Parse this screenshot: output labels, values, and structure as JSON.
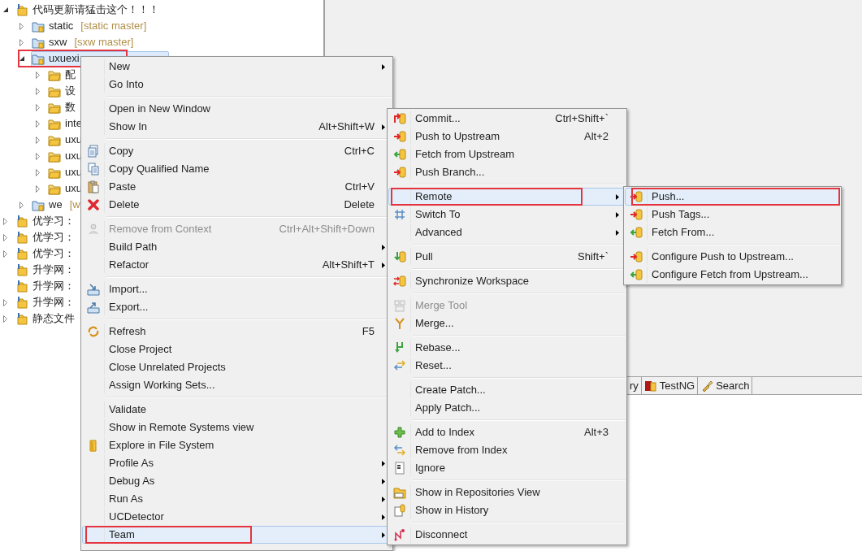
{
  "project_tree": [
    {
      "label": "代码更新请猛击这个！！！",
      "expanded": true,
      "selected": false,
      "annotated": false,
      "children": [
        {
          "label": "static",
          "decoration": "[static master]",
          "expanded": false,
          "selected": false,
          "annotated": false
        },
        {
          "label": "sxw",
          "decoration": "[sxw master]",
          "expanded": false,
          "selected": false,
          "annotated": false
        },
        {
          "label": "uxuexi",
          "expanded": true,
          "selected": true,
          "annotated": true,
          "children": [
            {
              "label": "配",
              "expanded": false,
              "selected": false,
              "annotated": false
            },
            {
              "label": "设",
              "expanded": false,
              "selected": false,
              "annotated": false
            },
            {
              "label": "数",
              "expanded": false,
              "selected": false,
              "annotated": false
            },
            {
              "label": "inte",
              "expanded": false,
              "selected": false,
              "annotated": false
            },
            {
              "label": "uxu",
              "expanded": false,
              "selected": false,
              "annotated": false
            },
            {
              "label": "uxu",
              "expanded": false,
              "selected": false,
              "annotated": false
            },
            {
              "label": "uxu",
              "expanded": false,
              "selected": false,
              "annotated": false
            },
            {
              "label": "uxu",
              "expanded": false,
              "selected": false,
              "annotated": false
            }
          ]
        },
        {
          "label": "we",
          "decoration": "[w",
          "expanded": false,
          "selected": false,
          "annotated": false
        }
      ]
    },
    {
      "label": "优学习：",
      "expanded": false,
      "selected": false,
      "annotated": false
    },
    {
      "label": "优学习：",
      "expanded": false,
      "selected": false,
      "annotated": false
    },
    {
      "label": "优学习：",
      "expanded": false,
      "selected": false,
      "annotated": false
    },
    {
      "label": "升学网：",
      "selected": false,
      "annotated": false
    },
    {
      "label": "升学网：",
      "selected": false,
      "annotated": false
    },
    {
      "label": "升学网：",
      "expanded": false,
      "selected": false,
      "annotated": false
    },
    {
      "label": "静态文件",
      "expanded": false,
      "selected": false,
      "annotated": false
    }
  ],
  "context_menu": {
    "items": [
      {
        "kind": "item",
        "label": "New",
        "has_submenu": true,
        "disabled": false,
        "selected": false,
        "annotated": false
      },
      {
        "kind": "item",
        "label": "Go Into",
        "disabled": false,
        "selected": false,
        "annotated": false
      },
      {
        "kind": "separator"
      },
      {
        "kind": "item",
        "label": "Open in New Window",
        "disabled": false,
        "selected": false,
        "annotated": false
      },
      {
        "kind": "item",
        "label": "Show In",
        "shortcut": "Alt+Shift+W",
        "has_submenu": true,
        "disabled": false,
        "selected": false,
        "annotated": false
      },
      {
        "kind": "separator"
      },
      {
        "kind": "item",
        "label": "Copy",
        "shortcut": "Ctrl+C",
        "disabled": false,
        "selected": false,
        "annotated": false
      },
      {
        "kind": "item",
        "label": "Copy Qualified Name",
        "disabled": false,
        "selected": false,
        "annotated": false
      },
      {
        "kind": "item",
        "label": "Paste",
        "shortcut": "Ctrl+V",
        "disabled": false,
        "selected": false,
        "annotated": false
      },
      {
        "kind": "item",
        "label": "Delete",
        "shortcut": "Delete",
        "disabled": false,
        "selected": false,
        "annotated": false
      },
      {
        "kind": "separator"
      },
      {
        "kind": "item",
        "label": "Remove from Context",
        "shortcut": "Ctrl+Alt+Shift+Down",
        "disabled": true,
        "selected": false,
        "annotated": false
      },
      {
        "kind": "item",
        "label": "Build Path",
        "has_submenu": true,
        "disabled": false,
        "selected": false,
        "annotated": false
      },
      {
        "kind": "item",
        "label": "Refactor",
        "shortcut": "Alt+Shift+T",
        "has_submenu": true,
        "disabled": false,
        "selected": false,
        "annotated": false
      },
      {
        "kind": "separator"
      },
      {
        "kind": "item",
        "label": "Import...",
        "disabled": false,
        "selected": false,
        "annotated": false
      },
      {
        "kind": "item",
        "label": "Export...",
        "disabled": false,
        "selected": false,
        "annotated": false
      },
      {
        "kind": "separator"
      },
      {
        "kind": "item",
        "label": "Refresh",
        "shortcut": "F5",
        "disabled": false,
        "selected": false,
        "annotated": false
      },
      {
        "kind": "item",
        "label": "Close Project",
        "disabled": false,
        "selected": false,
        "annotated": false
      },
      {
        "kind": "item",
        "label": "Close Unrelated Projects",
        "disabled": false,
        "selected": false,
        "annotated": false
      },
      {
        "kind": "item",
        "label": "Assign Working Sets...",
        "disabled": false,
        "selected": false,
        "annotated": false
      },
      {
        "kind": "separator"
      },
      {
        "kind": "item",
        "label": "Validate",
        "disabled": false,
        "selected": false,
        "annotated": false
      },
      {
        "kind": "item",
        "label": "Show in Remote Systems view",
        "disabled": false,
        "selected": false,
        "annotated": false
      },
      {
        "kind": "item",
        "label": "Explore in File System",
        "disabled": false,
        "selected": false,
        "annotated": false
      },
      {
        "kind": "item",
        "label": "Profile As",
        "has_submenu": true,
        "disabled": false,
        "selected": false,
        "annotated": false
      },
      {
        "kind": "item",
        "label": "Debug As",
        "has_submenu": true,
        "disabled": false,
        "selected": false,
        "annotated": false
      },
      {
        "kind": "item",
        "label": "Run As",
        "has_submenu": true,
        "disabled": false,
        "selected": false,
        "annotated": false
      },
      {
        "kind": "item",
        "label": "UCDetector",
        "has_submenu": true,
        "disabled": false,
        "selected": false,
        "annotated": false
      },
      {
        "kind": "item",
        "label": "Team",
        "has_submenu": true,
        "disabled": false,
        "selected": true,
        "annotated": true
      }
    ]
  },
  "team_submenu": {
    "items": [
      {
        "kind": "item",
        "label": "Commit...",
        "shortcut": "Ctrl+Shift+`",
        "disabled": false,
        "selected": false,
        "annotated": false
      },
      {
        "kind": "item",
        "label": "Push to Upstream",
        "shortcut": "Alt+2",
        "disabled": false,
        "selected": false,
        "annotated": false
      },
      {
        "kind": "item",
        "label": "Fetch from Upstream",
        "disabled": false,
        "selected": false,
        "annotated": false
      },
      {
        "kind": "item",
        "label": "Push Branch...",
        "disabled": false,
        "selected": false,
        "annotated": false
      },
      {
        "kind": "separator"
      },
      {
        "kind": "item",
        "label": "Remote",
        "has_submenu": true,
        "disabled": false,
        "selected": true,
        "annotated": true
      },
      {
        "kind": "item",
        "label": "Switch To",
        "has_submenu": true,
        "disabled": false,
        "selected": false,
        "annotated": false
      },
      {
        "kind": "item",
        "label": "Advanced",
        "has_submenu": true,
        "disabled": false,
        "selected": false,
        "annotated": false
      },
      {
        "kind": "separator"
      },
      {
        "kind": "item",
        "label": "Pull",
        "shortcut": "Shift+`",
        "disabled": false,
        "selected": false,
        "annotated": false
      },
      {
        "kind": "separator"
      },
      {
        "kind": "item",
        "label": "Synchronize Workspace",
        "disabled": false,
        "selected": false,
        "annotated": false
      },
      {
        "kind": "separator"
      },
      {
        "kind": "item",
        "label": "Merge Tool",
        "disabled": true,
        "selected": false,
        "annotated": false
      },
      {
        "kind": "item",
        "label": "Merge...",
        "disabled": false,
        "selected": false,
        "annotated": false
      },
      {
        "kind": "separator"
      },
      {
        "kind": "item",
        "label": "Rebase...",
        "disabled": false,
        "selected": false,
        "annotated": false
      },
      {
        "kind": "item",
        "label": "Reset...",
        "disabled": false,
        "selected": false,
        "annotated": false
      },
      {
        "kind": "separator"
      },
      {
        "kind": "item",
        "label": "Create Patch...",
        "disabled": false,
        "selected": false,
        "annotated": false
      },
      {
        "kind": "item",
        "label": "Apply Patch...",
        "disabled": false,
        "selected": false,
        "annotated": false
      },
      {
        "kind": "separator"
      },
      {
        "kind": "item",
        "label": "Add to Index",
        "shortcut": "Alt+3",
        "disabled": false,
        "selected": false,
        "annotated": false
      },
      {
        "kind": "item",
        "label": "Remove from Index",
        "disabled": false,
        "selected": false,
        "annotated": false
      },
      {
        "kind": "item",
        "label": "Ignore",
        "disabled": false,
        "selected": false,
        "annotated": false
      },
      {
        "kind": "separator"
      },
      {
        "kind": "item",
        "label": "Show in Repositories View",
        "disabled": false,
        "selected": false,
        "annotated": false
      },
      {
        "kind": "item",
        "label": "Show in History",
        "disabled": false,
        "selected": false,
        "annotated": false
      },
      {
        "kind": "separator"
      },
      {
        "kind": "item",
        "label": "Disconnect",
        "disabled": false,
        "selected": false,
        "annotated": false
      }
    ]
  },
  "remote_submenu": {
    "items": [
      {
        "kind": "item",
        "label": "Push...",
        "disabled": false,
        "selected": true,
        "annotated": true
      },
      {
        "kind": "item",
        "label": "Push Tags...",
        "disabled": false,
        "selected": false,
        "annotated": false
      },
      {
        "kind": "item",
        "label": "Fetch From...",
        "disabled": false,
        "selected": false,
        "annotated": false
      },
      {
        "kind": "separator"
      },
      {
        "kind": "item",
        "label": "Configure Push to Upstream...",
        "disabled": false,
        "selected": false,
        "annotated": false
      },
      {
        "kind": "item",
        "label": "Configure Fetch from Upstream...",
        "disabled": false,
        "selected": false,
        "annotated": false
      }
    ]
  },
  "view_tabs": [
    {
      "label": "ry"
    },
    {
      "label": "TestNG"
    },
    {
      "label": "Search"
    }
  ]
}
